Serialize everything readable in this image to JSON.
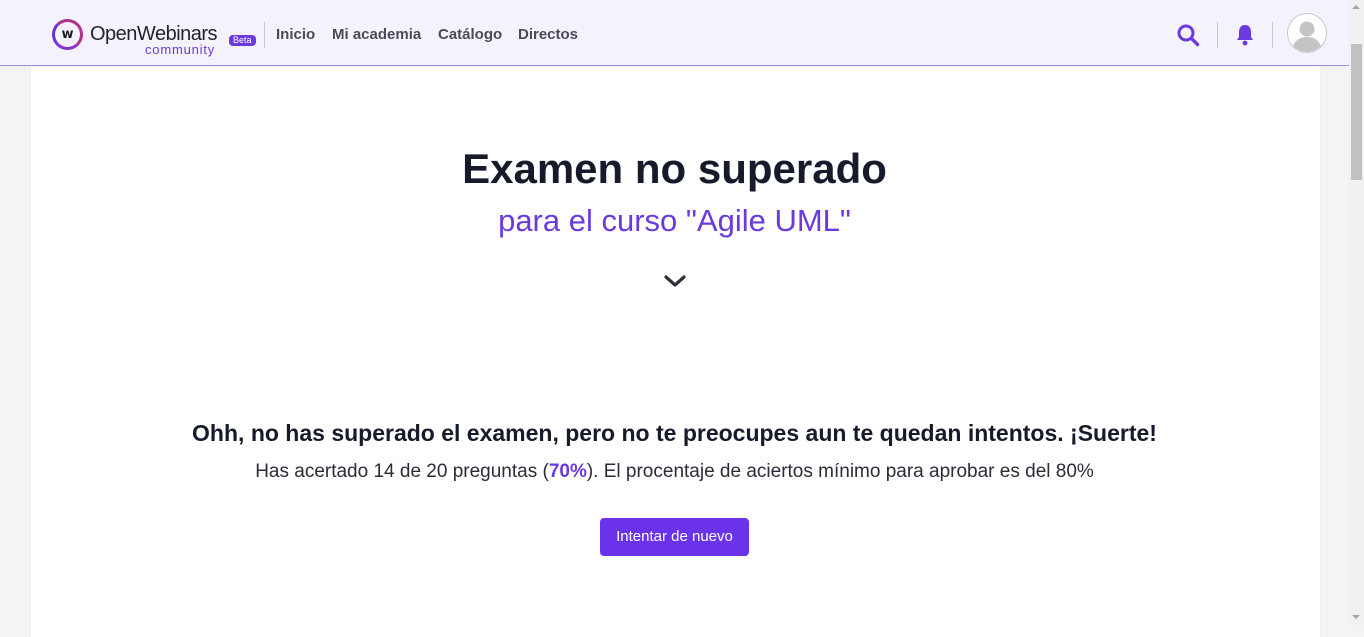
{
  "header": {
    "brand": {
      "name": "OpenWebinars",
      "sub": "community",
      "badge": "Beta",
      "logo_letter": "w"
    },
    "nav": [
      {
        "label": "Inicio"
      },
      {
        "label": "Mi academia"
      },
      {
        "label": "Catálogo"
      },
      {
        "label": "Directos"
      }
    ],
    "icons": {
      "search": "search-icon",
      "notifications": "bell-icon",
      "profile": "user-avatar"
    }
  },
  "main": {
    "title": "Examen no superado",
    "subtitle": "para el curso \"Agile UML\"",
    "expand_icon": "chevron-down-icon",
    "message": "Ohh, no has superado el examen, pero no te preocupes aun te quedan intentos. ¡Suerte!",
    "result": {
      "prefix": "Has acertado 14 de 20 preguntas (",
      "percent": "70%",
      "suffix": "). El procentaje de aciertos mínimo para aprobar es del 80%"
    },
    "retry_button": "Intentar de nuevo"
  },
  "colors": {
    "accent": "#6a3ae0",
    "button": "#6a33ea",
    "navbar_bg": "#f4f3fd",
    "title": "#171a2a"
  }
}
